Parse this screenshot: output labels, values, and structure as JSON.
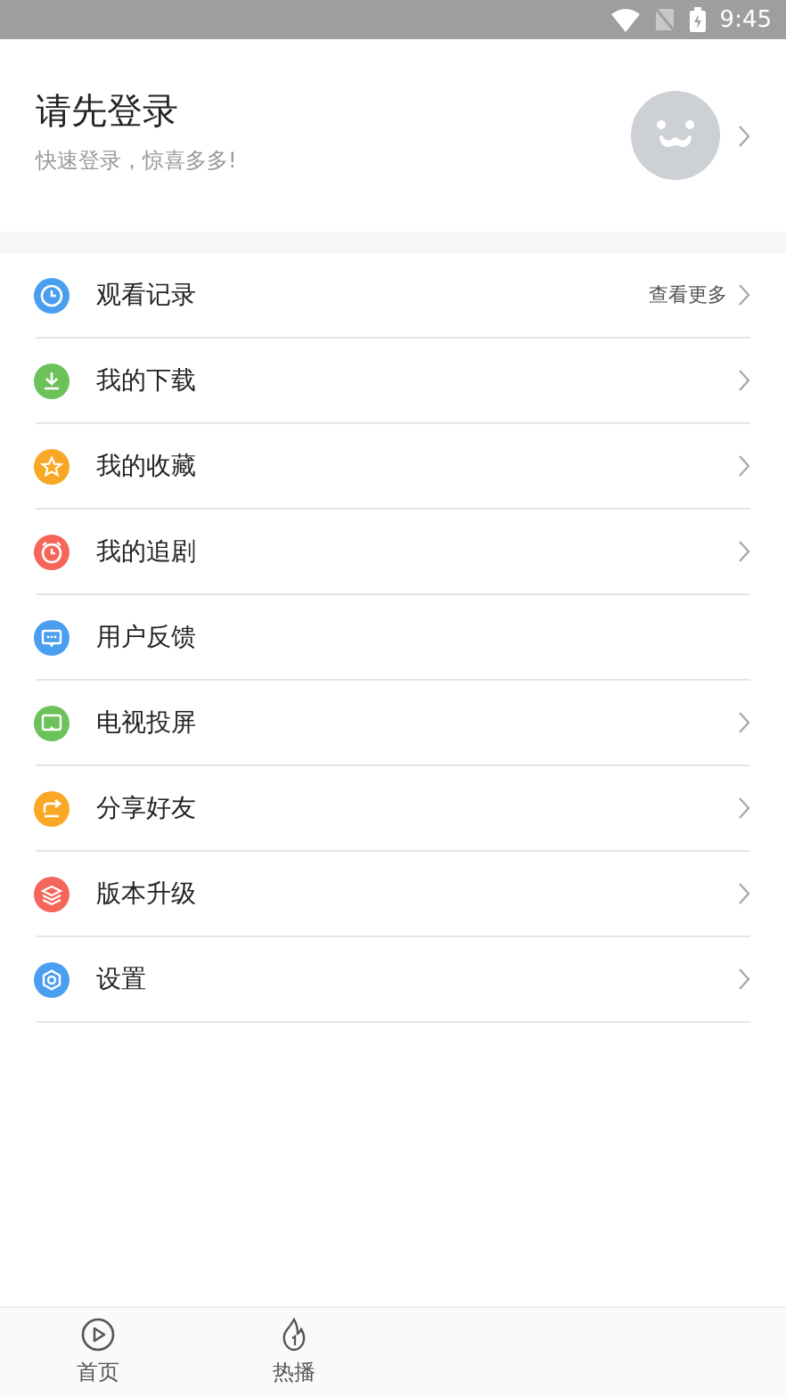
{
  "status_bar": {
    "time": "9:45"
  },
  "profile": {
    "title": "请先登录",
    "subtitle": "快速登录，惊喜多多!"
  },
  "menu": [
    {
      "label": "观看记录",
      "color": "#4a9ef0",
      "more": "查看更多",
      "chevron": true
    },
    {
      "label": "我的下载",
      "color": "#6cc25a",
      "chevron": true
    },
    {
      "label": "我的收藏",
      "color": "#f9a825",
      "chevron": true
    },
    {
      "label": "我的追剧",
      "color": "#f4665a",
      "chevron": true
    },
    {
      "label": "用户反馈",
      "color": "#4a9ef0",
      "chevron": false
    },
    {
      "label": "电视投屏",
      "color": "#6cc25a",
      "chevron": true
    },
    {
      "label": "分享好友",
      "color": "#f9a825",
      "chevron": true
    },
    {
      "label": "版本升级",
      "color": "#f4665a",
      "chevron": true
    },
    {
      "label": "设置",
      "color": "#4a9ef0",
      "chevron": true
    }
  ],
  "tab_bar": [
    {
      "label": "首页"
    },
    {
      "label": "热播"
    }
  ]
}
